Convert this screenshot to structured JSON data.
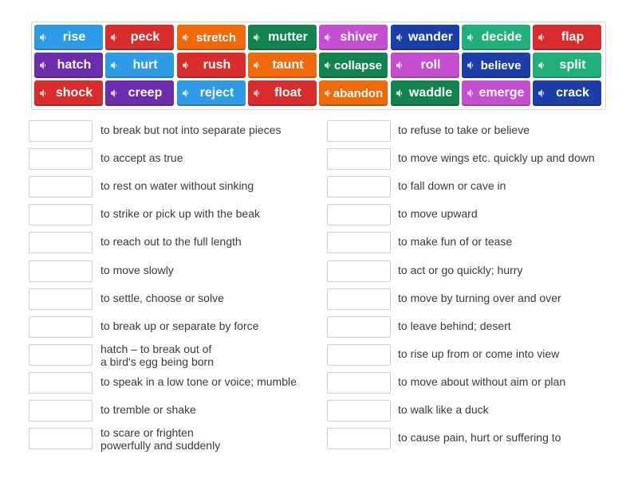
{
  "colors": {
    "blue": "#2d9be6",
    "red": "#d92c2c",
    "orange": "#f06a0c",
    "green": "#12834f",
    "pink": "#c54fd0",
    "navy": "#1c3ea8",
    "teal": "#22b07a",
    "purple": "#6b2cae"
  },
  "speaker_icon": "speaker-icon",
  "tiles": [
    {
      "word": "rise",
      "color": "blue"
    },
    {
      "word": "peck",
      "color": "red"
    },
    {
      "word": "stretch",
      "color": "orange"
    },
    {
      "word": "mutter",
      "color": "green"
    },
    {
      "word": "shiver",
      "color": "pink"
    },
    {
      "word": "wander",
      "color": "navy"
    },
    {
      "word": "decide",
      "color": "teal"
    },
    {
      "word": "flap",
      "color": "red"
    },
    {
      "word": "hatch",
      "color": "purple"
    },
    {
      "word": "hurt",
      "color": "blue"
    },
    {
      "word": "rush",
      "color": "red"
    },
    {
      "word": "taunt",
      "color": "orange"
    },
    {
      "word": "collapse",
      "color": "green"
    },
    {
      "word": "roll",
      "color": "pink"
    },
    {
      "word": "believe",
      "color": "navy"
    },
    {
      "word": "split",
      "color": "teal"
    },
    {
      "word": "shock",
      "color": "red"
    },
    {
      "word": "creep",
      "color": "purple"
    },
    {
      "word": "reject",
      "color": "blue"
    },
    {
      "word": "float",
      "color": "red"
    },
    {
      "word": "abandon",
      "color": "orange"
    },
    {
      "word": "waddle",
      "color": "green"
    },
    {
      "word": "emerge",
      "color": "pink"
    },
    {
      "word": "crack",
      "color": "navy"
    }
  ],
  "definitions_left": [
    {
      "lines": [
        "to break but not into separate pieces"
      ]
    },
    {
      "lines": [
        "to accept as true"
      ]
    },
    {
      "lines": [
        "to rest on water without sinking"
      ]
    },
    {
      "lines": [
        "to strike or pick up with the beak"
      ]
    },
    {
      "lines": [
        "to reach out to the full length"
      ]
    },
    {
      "lines": [
        "to move slowly"
      ]
    },
    {
      "lines": [
        "to settle, choose or solve"
      ]
    },
    {
      "lines": [
        "to break up or separate by force"
      ]
    },
    {
      "lines": [
        "hatch – to break out of",
        "a bird's egg being born"
      ]
    },
    {
      "lines": [
        "to speak in a low tone or voice; mumble"
      ]
    },
    {
      "lines": [
        "to tremble or shake"
      ]
    },
    {
      "lines": [
        "to scare or frighten",
        "powerfully and suddenly"
      ]
    }
  ],
  "definitions_right": [
    {
      "lines": [
        "to refuse to take or believe"
      ]
    },
    {
      "lines": [
        "to move wings etc. quickly up and down"
      ]
    },
    {
      "lines": [
        "to fall down or cave in"
      ]
    },
    {
      "lines": [
        "to move upward"
      ]
    },
    {
      "lines": [
        "to make fun of or tease"
      ]
    },
    {
      "lines": [
        "to act or go quickly; hurry"
      ]
    },
    {
      "lines": [
        "to move by turning over and over"
      ]
    },
    {
      "lines": [
        "to leave behind; desert"
      ]
    },
    {
      "lines": [
        "to rise up from or come into view"
      ]
    },
    {
      "lines": [
        "to move about without aim or plan"
      ]
    },
    {
      "lines": [
        "to walk like a duck"
      ]
    },
    {
      "lines": [
        "to cause pain, hurt or suffering to"
      ]
    }
  ]
}
